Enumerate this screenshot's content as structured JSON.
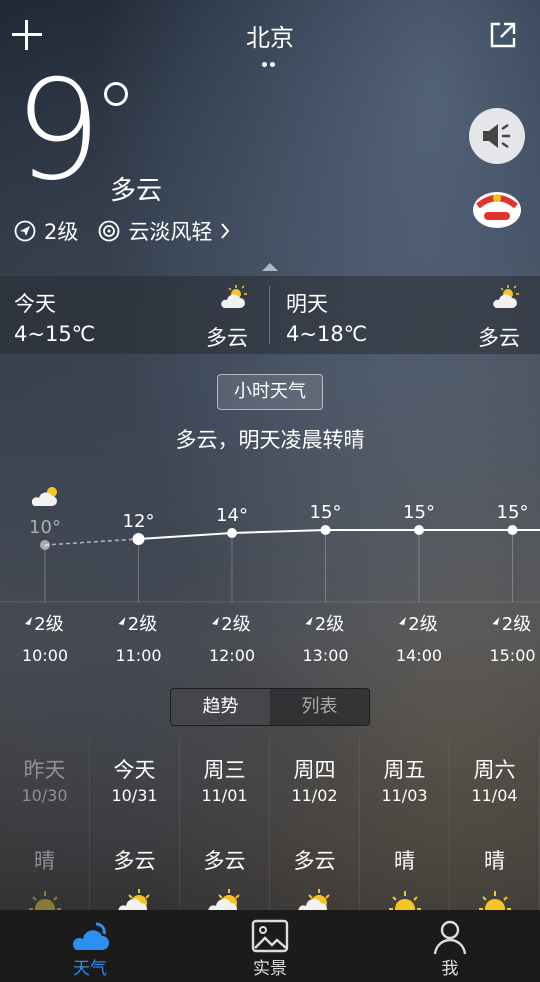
{
  "header": {
    "city": "北京"
  },
  "current": {
    "temp": "9",
    "condition": "多云",
    "wind": "2级",
    "air": "云淡风轻"
  },
  "days": {
    "today": {
      "name": "今天",
      "range": "4~15℃",
      "condition": "多云"
    },
    "tomorrow": {
      "name": "明天",
      "range": "4~18℃",
      "condition": "多云"
    }
  },
  "hourly": {
    "button": "小时天气",
    "summary": "多云，明天凌晨转晴",
    "points": [
      {
        "time": "10:00",
        "temp": 10,
        "label": "10°",
        "wind": "2级"
      },
      {
        "time": "11:00",
        "temp": 12,
        "label": "12°",
        "wind": "2级"
      },
      {
        "time": "12:00",
        "temp": 14,
        "label": "14°",
        "wind": "2级"
      },
      {
        "time": "13:00",
        "temp": 15,
        "label": "15°",
        "wind": "2级"
      },
      {
        "time": "14:00",
        "temp": 15,
        "label": "15°",
        "wind": "2级"
      },
      {
        "time": "15:00",
        "temp": 15,
        "label": "15°",
        "wind": "2级"
      }
    ]
  },
  "tabs": {
    "trend": "趋势",
    "list": "列表"
  },
  "daily": [
    {
      "week": "昨天",
      "date": "10/30",
      "cond": "晴",
      "icon": "sun-icon"
    },
    {
      "week": "今天",
      "date": "10/31",
      "cond": "多云",
      "icon": "partly-cloudy-icon"
    },
    {
      "week": "周三",
      "date": "11/01",
      "cond": "多云",
      "icon": "partly-cloudy-icon"
    },
    {
      "week": "周四",
      "date": "11/02",
      "cond": "多云",
      "icon": "partly-cloudy-icon"
    },
    {
      "week": "周五",
      "date": "11/03",
      "cond": "晴",
      "icon": "sun-icon"
    },
    {
      "week": "周六",
      "date": "11/04",
      "cond": "晴",
      "icon": "sun-icon"
    }
  ],
  "nav": {
    "weather": "天气",
    "scene": "实景",
    "me": "我"
  },
  "colors": {
    "accent": "#2e8ff0",
    "sun": "#f5c623"
  }
}
